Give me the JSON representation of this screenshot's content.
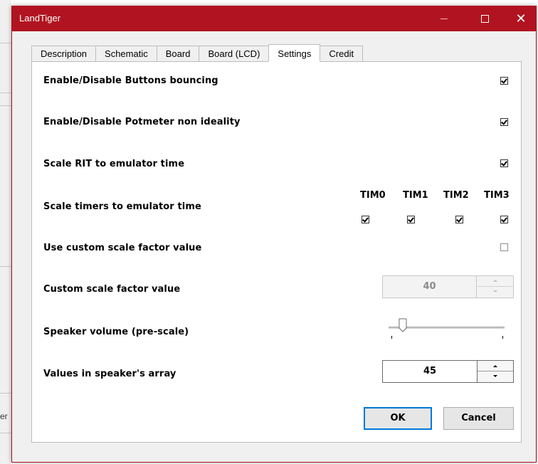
{
  "window": {
    "title": "LandTiger"
  },
  "titlebar": {
    "minimize": "—",
    "close": "✕"
  },
  "background": {
    "fragment_text": "er"
  },
  "tabs": [
    {
      "label": "Description",
      "active": false
    },
    {
      "label": "Schematic",
      "active": false
    },
    {
      "label": "Board",
      "active": false
    },
    {
      "label": "Board (LCD)",
      "active": false
    },
    {
      "label": "Settings",
      "active": true
    },
    {
      "label": "Credit",
      "active": false
    }
  ],
  "settings": {
    "buttons_bouncing": {
      "label": "Enable/Disable Buttons bouncing",
      "checked": true
    },
    "potmeter_non_ideality": {
      "label": "Enable/Disable Potmeter non ideality",
      "checked": true
    },
    "scale_rit": {
      "label": "Scale RIT to emulator time",
      "checked": true
    },
    "scale_timers": {
      "label": "Scale timers to emulator time",
      "timers": [
        {
          "label": "TIM0",
          "checked": true
        },
        {
          "label": "TIM1",
          "checked": true
        },
        {
          "label": "TIM2",
          "checked": true
        },
        {
          "label": "TIM3",
          "checked": true
        }
      ]
    },
    "use_custom_scale": {
      "label": "Use custom scale factor value",
      "checked": false
    },
    "custom_scale_value": {
      "label": "Custom scale factor value",
      "value": "40",
      "enabled": false
    },
    "speaker_volume": {
      "label": "Speaker volume (pre-scale)",
      "level": 0.12
    },
    "speaker_array": {
      "label": "Values in speaker's array",
      "value": "45"
    }
  },
  "buttons": {
    "ok": "OK",
    "cancel": "Cancel"
  },
  "colors": {
    "titlebar": "#b11420",
    "default_button_border": "#0078d7"
  }
}
